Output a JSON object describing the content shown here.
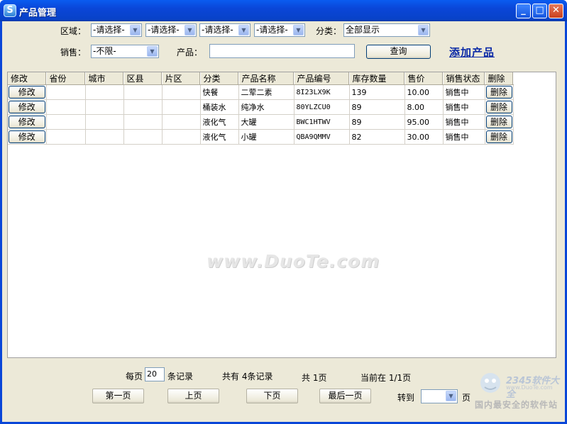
{
  "window": {
    "title": "产品管理",
    "app_icon": "S"
  },
  "filters": {
    "region_label": "区域：",
    "region_selects": [
      "-请选择-",
      "-请选择-",
      "-请选择-",
      "-请选择-"
    ],
    "category_label": "分类：",
    "category_value": "全部显示",
    "sales_label": "销售：",
    "sales_value": "-不限-",
    "product_label": "产品：",
    "product_value": "",
    "search_button": "查询",
    "add_product_link": "添加产品"
  },
  "table": {
    "columns": [
      "修改",
      "省份",
      "城市",
      "区县",
      "片区",
      "分类",
      "产品名称",
      "产品编号",
      "库存数量",
      "售价",
      "销售状态",
      "删除"
    ],
    "edit_label": "修改",
    "delete_label": "删除",
    "rows": [
      {
        "category": "快餐",
        "name": "二荤二素",
        "code": "8I23LX9K",
        "stock": "139",
        "price": "10.00",
        "status": "销售中"
      },
      {
        "category": "桶装水",
        "name": "纯净水",
        "code": "80YLZCU0",
        "stock": "89",
        "price": "8.00",
        "status": "销售中"
      },
      {
        "category": "液化气",
        "name": "大罐",
        "code": "BWC1HTWV",
        "stock": "89",
        "price": "95.00",
        "status": "销售中"
      },
      {
        "category": "液化气",
        "name": "小罐",
        "code": "QBA9QMMV",
        "stock": "82",
        "price": "30.00",
        "status": "销售中"
      }
    ]
  },
  "watermark": "www.DuoTe.com",
  "pager": {
    "per_page_prefix": "每页",
    "per_page_value": "20",
    "per_page_suffix": "条记录",
    "total_records": "共有 4条记录",
    "total_pages": "共 1页",
    "current_page": "当前在 1/1页",
    "first_button": "第一页",
    "prev_button": "上页",
    "next_button": "下页",
    "last_button": "最后一页",
    "goto_label": "转到",
    "goto_value": "",
    "goto_suffix": "页"
  },
  "site_logo": {
    "brand": "2345软件大全",
    "site": "www.DuoTe.com",
    "slogan": "国内最安全的软件站"
  }
}
